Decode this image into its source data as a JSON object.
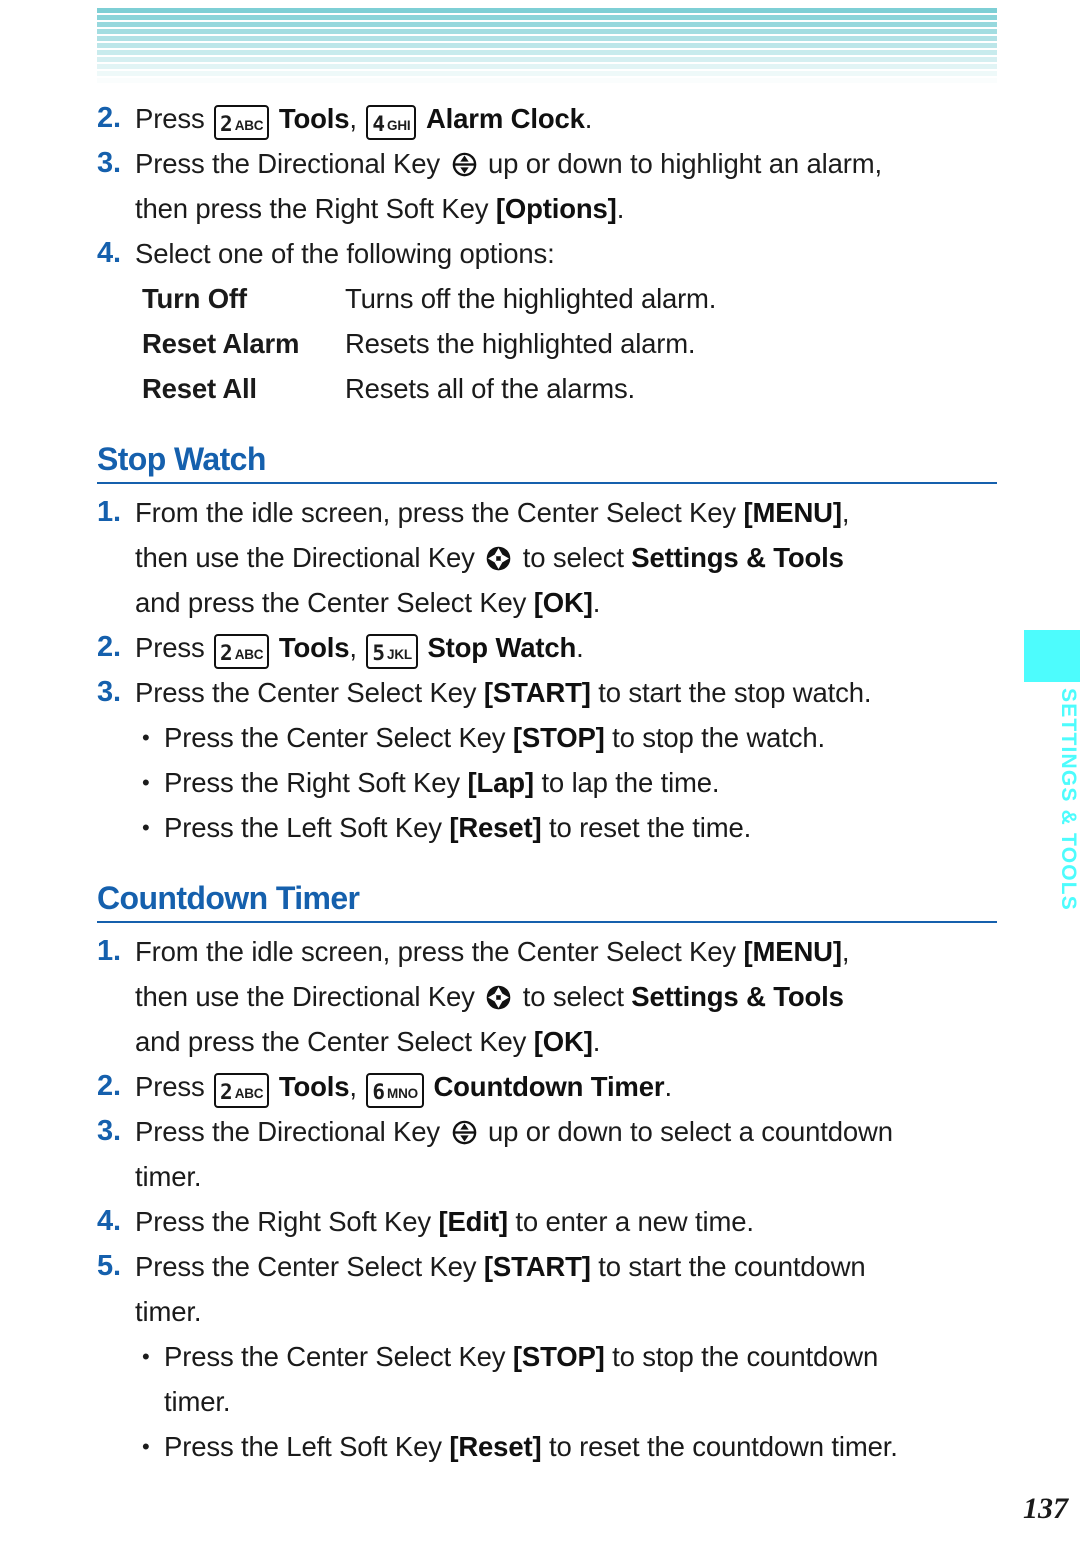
{
  "page": {
    "folio": "137",
    "accent_blue": "#1560ad",
    "accent_cyan": "#4dfcfd",
    "header_stripe_color": "#7ecfd5"
  },
  "side_tab": {
    "label": "SETTINGS & TOOLS"
  },
  "alarm_clock_section": {
    "steps": [
      {
        "num": "2.",
        "pre": "Press ",
        "key1": {
          "digit": "2",
          "letters": "ABC"
        },
        "bold1": "Tools",
        "mid": ", ",
        "key2": {
          "digit": "4",
          "letters": "GHI"
        },
        "bold2": "Alarm Clock",
        "post": "."
      },
      {
        "num": "3.",
        "pre": "Press the Directional Key ",
        "icon": "direction-key-updown-icon",
        "post": " up or down to highlight an alarm,",
        "cont_pre": "then press the Right Soft Key ",
        "cont_bold": "[Options]",
        "cont_post": "."
      },
      {
        "num": "4.",
        "text": "Select one of the following options:"
      }
    ],
    "options": [
      {
        "term": "Turn Off",
        "def": "Turns off the highlighted alarm."
      },
      {
        "term": "Reset Alarm",
        "def": "Resets the highlighted alarm."
      },
      {
        "term": "Reset All",
        "def": "Resets all of the alarms."
      }
    ]
  },
  "stop_watch_section": {
    "heading": "Stop Watch",
    "step1": {
      "num": "1.",
      "line1_pre": "From the idle screen, press the Center Select Key ",
      "line1_bold": "[MENU]",
      "line1_post": ",",
      "line2_pre": "then use the Directional Key ",
      "line2_icon": "direction-key-4way-icon",
      "line2_mid": " to select ",
      "line2_bold": "Settings & Tools",
      "line3_pre": "and press the Center Select Key ",
      "line3_bold": "[OK]",
      "line3_post": "."
    },
    "step2": {
      "num": "2.",
      "pre": "Press ",
      "key1": {
        "digit": "2",
        "letters": "ABC"
      },
      "bold1": "Tools",
      "mid": ", ",
      "key2": {
        "digit": "5",
        "letters": "JKL"
      },
      "bold2": "Stop Watch",
      "post": "."
    },
    "step3": {
      "num": "3.",
      "pre": "Press the Center Select Key ",
      "bold": "[START]",
      "post": " to start the stop watch."
    },
    "bullets": [
      {
        "dot": "•",
        "pre": "Press the Center Select Key ",
        "bold": "[STOP]",
        "post": " to stop the watch."
      },
      {
        "dot": "•",
        "pre": "Press the Right Soft Key ",
        "bold": "[Lap]",
        "post": " to lap the time."
      },
      {
        "dot": "•",
        "pre": "Press the Left Soft Key ",
        "bold": "[Reset]",
        "post": " to reset the time."
      }
    ]
  },
  "countdown_timer_section": {
    "heading": "Countdown Timer",
    "step1": {
      "num": "1.",
      "line1_pre": "From the idle screen, press the Center Select Key ",
      "line1_bold": "[MENU]",
      "line1_post": ",",
      "line2_pre": "then use the Directional Key ",
      "line2_icon": "direction-key-4way-icon",
      "line2_mid": " to select ",
      "line2_bold": "Settings & Tools",
      "line3_pre": "and press the Center Select Key ",
      "line3_bold": "[OK]",
      "line3_post": "."
    },
    "step2": {
      "num": "2.",
      "pre": "Press ",
      "key1": {
        "digit": "2",
        "letters": "ABC"
      },
      "bold1": "Tools",
      "mid": ", ",
      "key2": {
        "digit": "6",
        "letters": "MNO"
      },
      "bold2": "Countdown Timer",
      "post": "."
    },
    "step3": {
      "num": "3.",
      "pre": "Press the Directional Key ",
      "icon": "direction-key-updown-icon",
      "post": " up or down to select a countdown",
      "cont": "timer."
    },
    "step4": {
      "num": "4.",
      "pre": "Press the Right Soft Key ",
      "bold": "[Edit]",
      "post": " to enter a new time."
    },
    "step5": {
      "num": "5.",
      "pre": "Press the Center Select Key ",
      "bold": "[START]",
      "post": " to start the countdown",
      "cont": "timer."
    },
    "bullets": [
      {
        "dot": "•",
        "pre": "Press the Center Select Key ",
        "bold": "[STOP]",
        "post": " to stop the countdown",
        "cont": "timer."
      },
      {
        "dot": "•",
        "pre": "Press the Left Soft Key ",
        "bold": "[Reset]",
        "post": " to reset the countdown timer."
      }
    ]
  }
}
